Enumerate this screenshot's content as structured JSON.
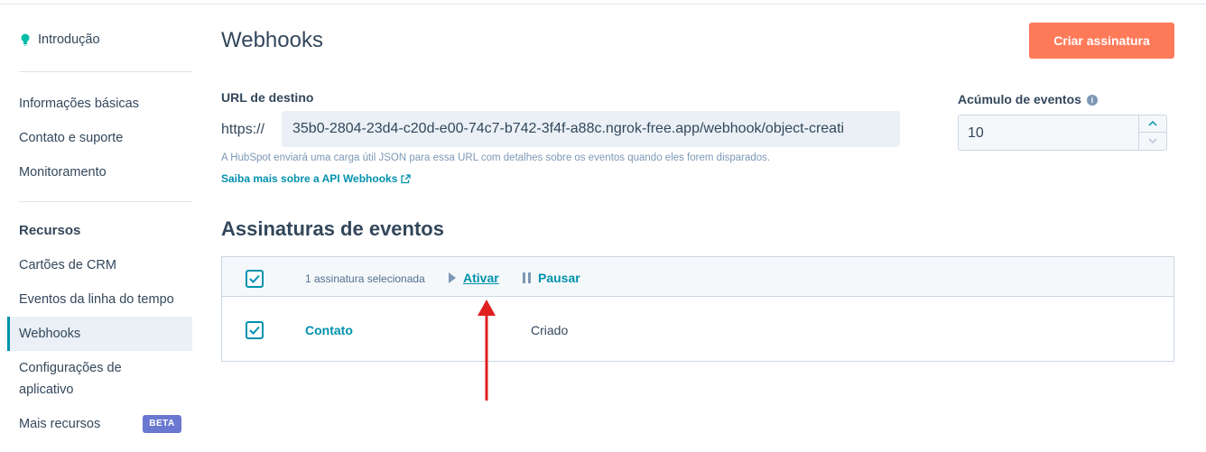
{
  "sidebar": {
    "intro": "Introdução",
    "items_top": [
      "Informações básicas",
      "Contato e suporte",
      "Monitoramento"
    ],
    "resources_heading": "Recursos",
    "items_resources": [
      "Cartões de CRM",
      "Eventos da linha do tempo",
      "Webhooks",
      "Configurações de",
      "aplicativo",
      "Mais recursos"
    ],
    "beta_badge": "BETA"
  },
  "header": {
    "title": "Webhooks",
    "create_button": "Criar assinatura"
  },
  "target_url": {
    "label": "URL de destino",
    "prefix": "https://",
    "value": "35b0-2804-23d4-c20d-e00-74c7-b742-3f4f-a88c.ngrok-free.app/webhook/object-creati",
    "help": "A HubSpot enviará uma carga útil JSON para essa URL com detalhes sobre os eventos quando eles forem disparados.",
    "link": "Saiba mais sobre a API Webhooks"
  },
  "event_batch": {
    "label": "Acúmulo de eventos",
    "value": "10"
  },
  "subscriptions": {
    "title": "Assinaturas de eventos",
    "selected_text": "1 assinatura selecionada",
    "activate": "Ativar",
    "pause": "Pausar",
    "rows": [
      {
        "object": "Contato",
        "event": "Criado",
        "checked": true
      }
    ]
  },
  "colors": {
    "accent": "#0091ae",
    "primary_button": "#ff7a59",
    "annotation_arrow": "#e02020",
    "beta": "#6a78d1"
  }
}
